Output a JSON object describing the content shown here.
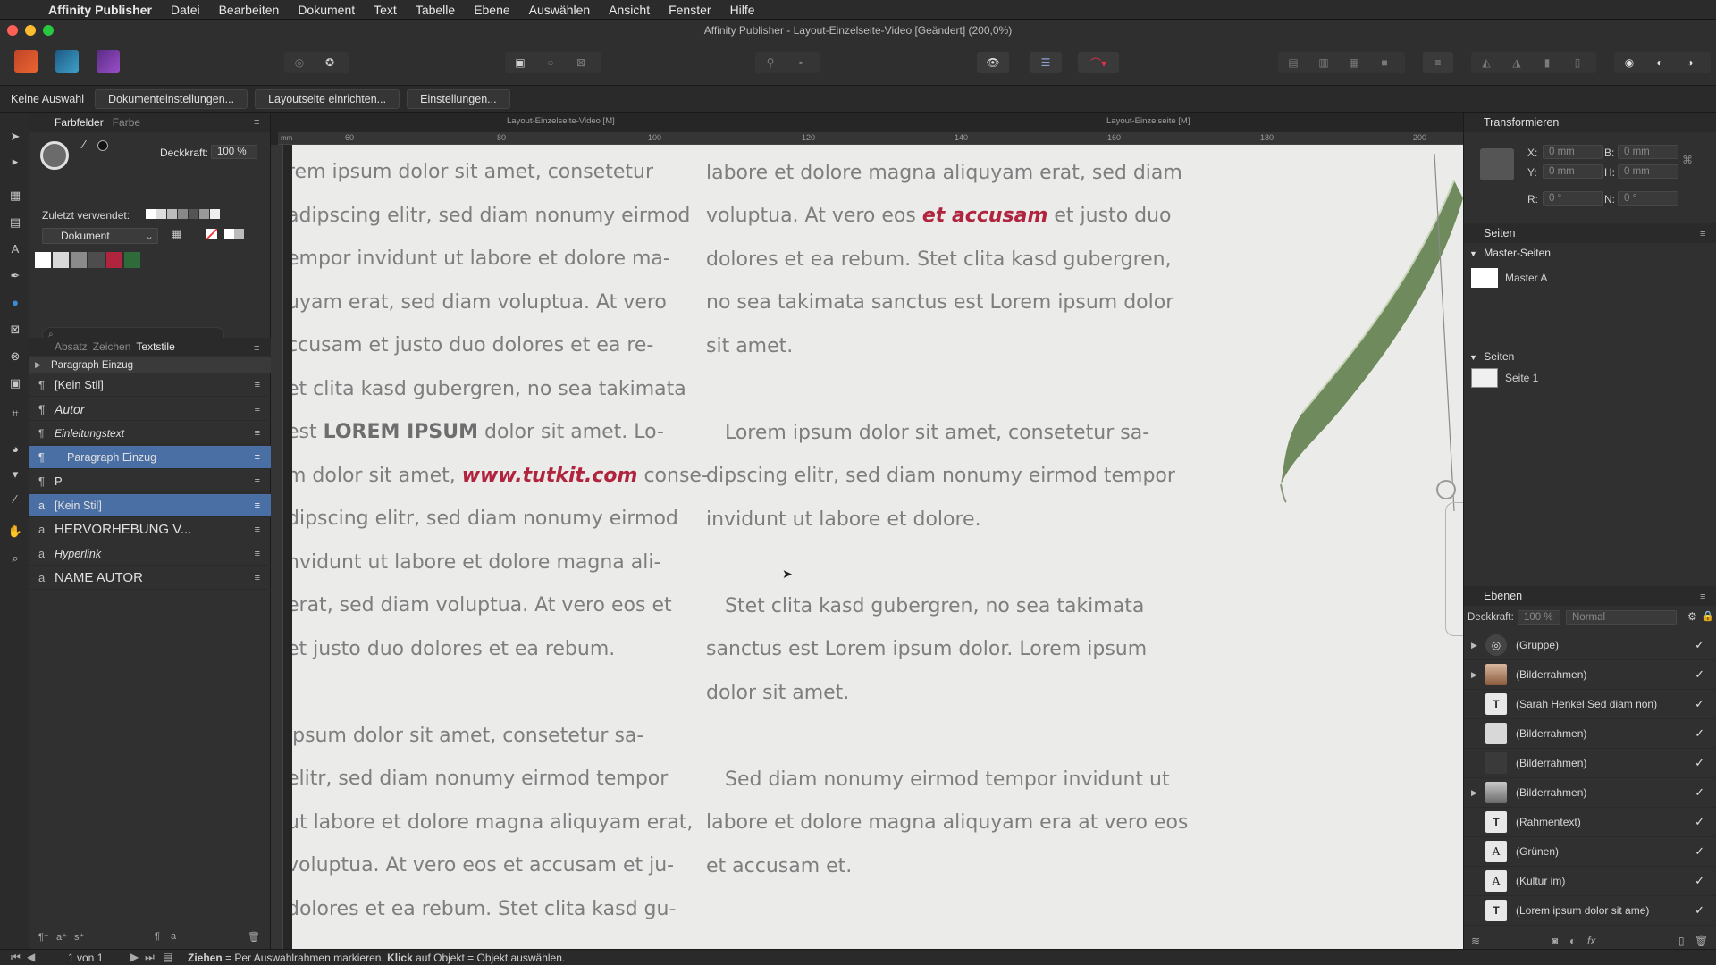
{
  "menubar": {
    "app": "Affinity Publisher",
    "items": [
      "Datei",
      "Bearbeiten",
      "Dokument",
      "Text",
      "Tabelle",
      "Ebene",
      "Auswählen",
      "Ansicht",
      "Fenster",
      "Hilfe"
    ]
  },
  "window": {
    "title": "Affinity Publisher - Layout-Einzelseite-Video [Geändert] (200,0%)"
  },
  "context": {
    "selection": "Keine Auswahl",
    "buttons": [
      "Dokumenteinstellungen...",
      "Layoutseite einrichten...",
      "Einstellungen..."
    ]
  },
  "left_panel": {
    "tabs": [
      "Farbfelder",
      "Farbe"
    ],
    "opacity_label": "Deckkraft:",
    "opacity_value": "100 %",
    "recent_label": "Zuletzt verwendet:",
    "palette": "Dokument",
    "style_tabs": [
      "Absatz",
      "Zeichen",
      "Textstile"
    ],
    "group_label": "Paragraph Einzug",
    "styles": [
      {
        "icon": "¶",
        "label": "[Kein Stil]",
        "italic": false
      },
      {
        "icon": "¶",
        "label": "Autor",
        "italic": true
      },
      {
        "icon": "¶",
        "label": "Einleitungstext",
        "italic": true
      },
      {
        "icon": "¶",
        "label": "Paragraph Einzug",
        "italic": false,
        "selected": true
      },
      {
        "icon": "¶",
        "label": "P",
        "italic": false
      },
      {
        "icon": "a",
        "label": "[Kein Stil]",
        "italic": false,
        "selected": true
      },
      {
        "icon": "a",
        "label": "HERVORHEBUNG V...",
        "italic": false
      },
      {
        "icon": "a",
        "label": "Hyperlink",
        "italic": true
      },
      {
        "icon": "a",
        "label": "NAME AUTOR",
        "italic": false
      }
    ]
  },
  "canvas": {
    "tab_left": "Layout-Einzelseite-Video [M]",
    "tab_right": "Layout-Einzelseite [M]",
    "ruler_ticks": [
      "60",
      "80",
      "100",
      "120",
      "140",
      "160",
      "180",
      "200"
    ],
    "left_column": [
      "rem ipsum dolor sit amet, consetetur",
      "adipscing elitr, sed diam nonumy eirmod",
      "empor invidunt ut labore et dolore ma-",
      "uyam erat, sed diam voluptua. At vero",
      "ccusam et justo duo dolores et ea re-",
      "et clita kasd gubergren, no sea takimata",
      "est ",
      "LOREM IPSUM",
      " dolor sit amet. Lo-",
      "m dolor sit amet, ",
      "www.tutkit.com",
      " conse-",
      "dipscing elitr, sed diam nonumy eirmod",
      "nvidunt ut labore et dolore magna ali-",
      "erat, sed diam voluptua. At vero eos et",
      " et justo duo dolores et ea rebum.",
      "",
      " ipsum dolor sit amet, consetetur sa-",
      "elitr, sed diam nonumy eirmod tempor",
      "ut labore et dolore magna aliquyam erat,",
      "voluptua. At vero eos et accusam et ju-",
      "dolores et ea rebum. Stet clita kasd gu-"
    ],
    "right_column": [
      "labore et dolore magna aliquyam erat, sed diam",
      "voluptua. At vero eos ",
      "et accusam",
      " et justo duo",
      "dolores et ea rebum. Stet clita kasd gubergren,",
      "no sea takimata sanctus est Lorem ipsum dolor",
      "sit amet.",
      "",
      "   Lorem ipsum dolor sit amet, consetetur sa-",
      "dipscing elitr, sed diam nonumy eirmod tempor",
      "invidunt ut labore et dolore.",
      "",
      "   Stet clita kasd gubergren, no sea takimata",
      "sanctus est Lorem ipsum dolor. Lorem ipsum",
      "dolor sit amet.",
      "",
      "   Sed diam nonumy eirmod tempor invidunt ut",
      "labore et dolore magna aliquyam era at vero eos",
      "et accusam et."
    ]
  },
  "right_panel": {
    "transform_title": "Transformieren",
    "x_label": "X:",
    "x_value": "0 mm",
    "y_label": "Y:",
    "y_value": "0 mm",
    "b_label": "B:",
    "b_value": "0 mm",
    "h_label": "H:",
    "h_value": "0 mm",
    "r_label": "R:",
    "r_value": "0 °",
    "n_label": "N:",
    "n_value": "0 °",
    "pages_title": "Seiten",
    "master_title": "Master-Seiten",
    "master_a": "Master A",
    "pages_sub": "Seiten",
    "page_1": "Seite 1",
    "layers_title": "Ebenen",
    "layers_opacity_label": "Deckkraft:",
    "layers_opacity": "100 %",
    "blend_mode": "Normal",
    "layers": [
      {
        "name": "(Gruppe)",
        "thumb": "group",
        "expand": true
      },
      {
        "name": "(Bilderrahmen)",
        "thumb": "portrait",
        "expand": true
      },
      {
        "name": "(Sarah Henkel Sed diam non)",
        "thumb": "text",
        "expand": false
      },
      {
        "name": "(Bilderrahmen)",
        "thumb": "light",
        "expand": false
      },
      {
        "name": "(Bilderrahmen)",
        "thumb": "dark",
        "expand": false
      },
      {
        "name": "(Bilderrahmen)",
        "thumb": "portrait2",
        "expand": true
      },
      {
        "name": "(Rahmentext)",
        "thumb": "text",
        "expand": false
      },
      {
        "name": "(Grünen)",
        "thumb": "art",
        "expand": false
      },
      {
        "name": "(Kultur im)",
        "thumb": "art",
        "expand": false
      },
      {
        "name": "(Lorem ipsum dolor sit ame)",
        "thumb": "text",
        "expand": false
      }
    ]
  },
  "status": {
    "page_counter": "1 von 1",
    "hint_drag": "Ziehen",
    "hint_drag_text": " = Per Auswahlrahmen markieren. ",
    "hint_click": "Klick",
    "hint_click_text": " auf Objekt = Objekt auswählen."
  },
  "colors": {
    "accent_selection": "#4a6fa5",
    "link_red": "#b0243d",
    "page_bg": "#ebebea"
  }
}
